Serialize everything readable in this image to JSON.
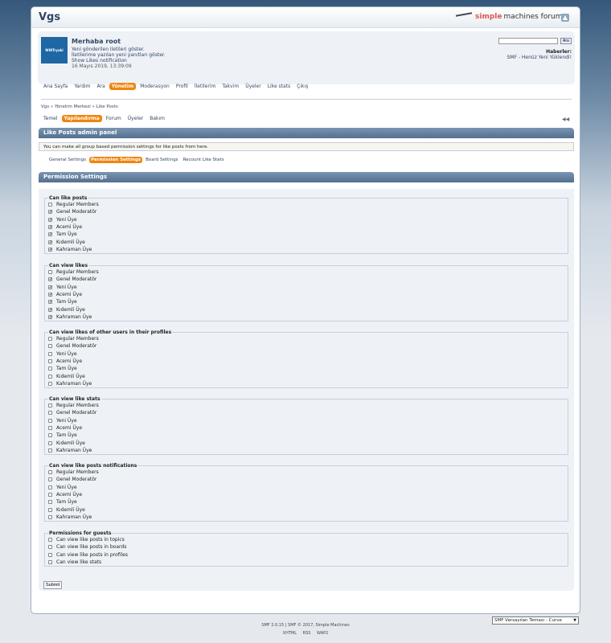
{
  "header": {
    "forum_title": "Vgs",
    "smf_logo_a": "simple",
    "smf_logo_b": "machines forum"
  },
  "user": {
    "avatar_text": "WWTryaki",
    "greeting": "Merhaba root",
    "links": [
      "Yeni gönderilen iletileri göster.",
      "İletilerime yazılan yeni yanıtları göster.",
      "Show Likes notification"
    ],
    "datetime": "16 Mayıs 2019, 13:39:09"
  },
  "search": {
    "placeholder": "",
    "button": "Ara"
  },
  "news": {
    "heading": "Haberler:",
    "text": "SMF - Henüz Yeni Yüklendi!"
  },
  "main_nav": [
    {
      "label": "Ana Sayfa",
      "active": false
    },
    {
      "label": "Yardım",
      "active": false
    },
    {
      "label": "Ara",
      "active": false
    },
    {
      "label": "Yönetim",
      "active": true
    },
    {
      "label": "Moderasyon",
      "active": false
    },
    {
      "label": "Profil",
      "active": false
    },
    {
      "label": "İletilerim",
      "active": false
    },
    {
      "label": "Takvim",
      "active": false
    },
    {
      "label": "Üyeler",
      "active": false
    },
    {
      "label": "Like stats",
      "active": false
    },
    {
      "label": "Çıkış",
      "active": false
    }
  ],
  "breadcrumb": "Vgs » Yönetim Merkezi » Like Posts",
  "sub_nav": [
    {
      "label": "Temel",
      "active": false
    },
    {
      "label": "Yapılandırma",
      "active": true
    },
    {
      "label": "Forum",
      "active": false
    },
    {
      "label": "Üyeler",
      "active": false
    },
    {
      "label": "Bakım",
      "active": false
    }
  ],
  "rewind_icon": "◀◀",
  "admin_panel_title": "Like Posts admin panel",
  "admin_panel_info": "You can make all group based permission settings for like posts from here.",
  "tabs": [
    {
      "label": "General Settings",
      "active": false
    },
    {
      "label": "Permission Settings",
      "active": true
    },
    {
      "label": "Board Settings",
      "active": false
    },
    {
      "label": "Recount Like Stats",
      "active": false
    }
  ],
  "permission_title": "Permission Settings",
  "groups": [
    {
      "legend": "Can like posts",
      "items": [
        {
          "label": "Regular Members",
          "checked": false
        },
        {
          "label": "Genel Moderatör",
          "checked": true
        },
        {
          "label": "Yeni Üye",
          "checked": true
        },
        {
          "label": "Acemi Üye",
          "checked": true
        },
        {
          "label": "Tam Üye",
          "checked": true
        },
        {
          "label": "Kıdemli Üye",
          "checked": true
        },
        {
          "label": "Kahraman Üye",
          "checked": true
        }
      ]
    },
    {
      "legend": "Can view likes",
      "items": [
        {
          "label": "Regular Members",
          "checked": false
        },
        {
          "label": "Genel Moderatör",
          "checked": true
        },
        {
          "label": "Yeni Üye",
          "checked": true
        },
        {
          "label": "Acemi Üye",
          "checked": true
        },
        {
          "label": "Tam Üye",
          "checked": true
        },
        {
          "label": "Kıdemli Üye",
          "checked": true
        },
        {
          "label": "Kahraman Üye",
          "checked": true
        }
      ]
    },
    {
      "legend": "Can view likes of other users in their profiles",
      "items": [
        {
          "label": "Regular Members",
          "checked": false
        },
        {
          "label": "Genel Moderatör",
          "checked": false
        },
        {
          "label": "Yeni Üye",
          "checked": false
        },
        {
          "label": "Acemi Üye",
          "checked": false
        },
        {
          "label": "Tam Üye",
          "checked": false
        },
        {
          "label": "Kıdemli Üye",
          "checked": false
        },
        {
          "label": "Kahraman Üye",
          "checked": false
        }
      ]
    },
    {
      "legend": "Can view like stats",
      "items": [
        {
          "label": "Regular Members",
          "checked": false
        },
        {
          "label": "Genel Moderatör",
          "checked": false
        },
        {
          "label": "Yeni Üye",
          "checked": false
        },
        {
          "label": "Acemi Üye",
          "checked": false
        },
        {
          "label": "Tam Üye",
          "checked": false
        },
        {
          "label": "Kıdemli Üye",
          "checked": false
        },
        {
          "label": "Kahraman Üye",
          "checked": false
        }
      ]
    },
    {
      "legend": "Can view like posts notifications",
      "items": [
        {
          "label": "Regular Members",
          "checked": false
        },
        {
          "label": "Genel Moderatör",
          "checked": false
        },
        {
          "label": "Yeni Üye",
          "checked": false
        },
        {
          "label": "Acemi Üye",
          "checked": false
        },
        {
          "label": "Tam Üye",
          "checked": false
        },
        {
          "label": "Kıdemli Üye",
          "checked": false
        },
        {
          "label": "Kahraman Üye",
          "checked": false
        }
      ]
    },
    {
      "legend": "Permissions for guests",
      "items": [
        {
          "label": "Can view like posts in topics",
          "checked": false
        },
        {
          "label": "Can view like posts in boards",
          "checked": false
        },
        {
          "label": "Can view like posts in profiles",
          "checked": false
        },
        {
          "label": "Can view like stats",
          "checked": false
        }
      ]
    }
  ],
  "submit_label": "Submit",
  "theme_select": "SMF Varsayılan Teması - Curve",
  "footer": {
    "copyright": "SMF 2.0.15 | SMF © 2017, Simple Machines",
    "links": [
      "XHTML",
      "RSS",
      "WAP2"
    ]
  },
  "colors": {
    "accent_orange": "#f0850f",
    "header_blue": "#536f8f"
  }
}
